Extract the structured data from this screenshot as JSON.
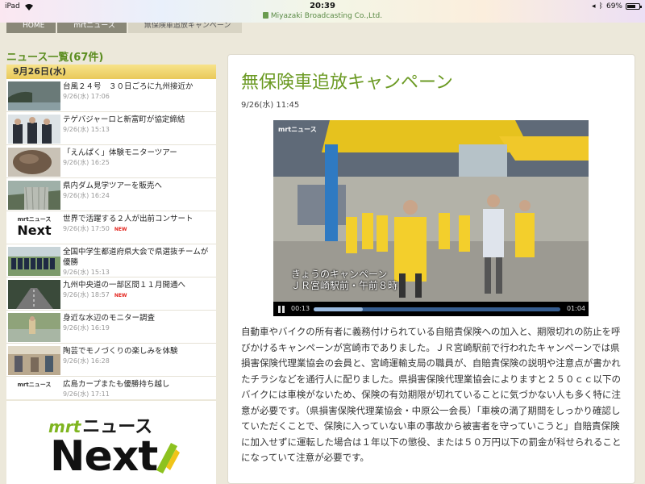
{
  "statusbar": {
    "device": "iPad",
    "time": "20:39",
    "url": "Miyazaki Broadcasting Co.,Ltd.",
    "battery": "69%",
    "battery_level": 0.69
  },
  "breadcrumb": [
    "HOME",
    "mrtニュース",
    "無保険車追放キャンペーン"
  ],
  "sidebar": {
    "heading": "ニュース一覧(67件)",
    "date": "9月26日(水)",
    "items": [
      {
        "title": "台風２４号　３０日ごろに九州接近か",
        "date": "9/26(水) 17:06",
        "new": ""
      },
      {
        "title": "テゲバジャーロと新富町が協定締結",
        "date": "9/26(水) 15:13",
        "new": ""
      },
      {
        "title": "「えんぱく」体験モニターツアー",
        "date": "9/26(水) 16:25",
        "new": ""
      },
      {
        "title": "県内ダム見学ツアーを販売へ",
        "date": "9/26(水) 16:24",
        "new": ""
      },
      {
        "title": "世界で活躍する２人が出前コンサート",
        "date": "9/26(水) 17:50",
        "new": "NEW"
      },
      {
        "title": "全国中学生都道府県大会で県選抜チームが優勝",
        "date": "9/26(水) 15:13",
        "new": ""
      },
      {
        "title": "九州中央道の一部区間１１月開通へ",
        "date": "9/26(水) 18:57",
        "new": "NEW"
      },
      {
        "title": "身近な水辺のモニター調査",
        "date": "9/26(水) 16:19",
        "new": ""
      },
      {
        "title": "陶芸でモノづくりの楽しみを体験",
        "date": "9/26(水) 16:28",
        "new": ""
      },
      {
        "title": "広島カープまたも優勝持ち越し",
        "date": "9/26(水) 17:11",
        "new": ""
      }
    ],
    "logo_small": "mrtニュース",
    "logo_next": "Next"
  },
  "promo": {
    "brand": "mrt",
    "label": "ニュース",
    "next": "Next"
  },
  "article": {
    "title": "無保険車追放キャンペーン",
    "datetime": "9/26(水) 11:45",
    "video": {
      "logo": "mrtニュース",
      "caption_line1": "きょうのキャンペーン",
      "caption_line2": "ＪＲ宮崎駅前・午前８時",
      "current": "00:13",
      "duration": "01:04",
      "progress": 0.2
    },
    "body": "自動車やバイクの所有者に義務付けられている自賠責保険への加入と、期限切れの防止を呼びかけるキャンペーンが宮崎市でありました。ＪＲ宮崎駅前で行われたキャンペーンでは県損害保険代理業協会の会員と、宮崎運輸支局の職員が、自賠責保険の説明や注意点が書かれたチラシなどを通行人に配りました。県損害保険代理業協会によりますと２５０ｃｃ以下のバイクには車検がないため、保険の有効期限が切れていることに気づかない人も多く特に注意が必要です。（県損害保険代理業協会・中原公一会長）「車検の満了期間をしっかり確認していただくことで、保険に入っていない車の事故から被害者を守っていこうと」自賠責保険に加入せずに運転した場合は１年以下の懲役、または５０万円以下の罰金が科せられることになっていて注意が必要です。"
  },
  "colors": {
    "accent_green": "#6b9a23",
    "new_red": "#e3231c",
    "date_bar": "#f0d470"
  }
}
